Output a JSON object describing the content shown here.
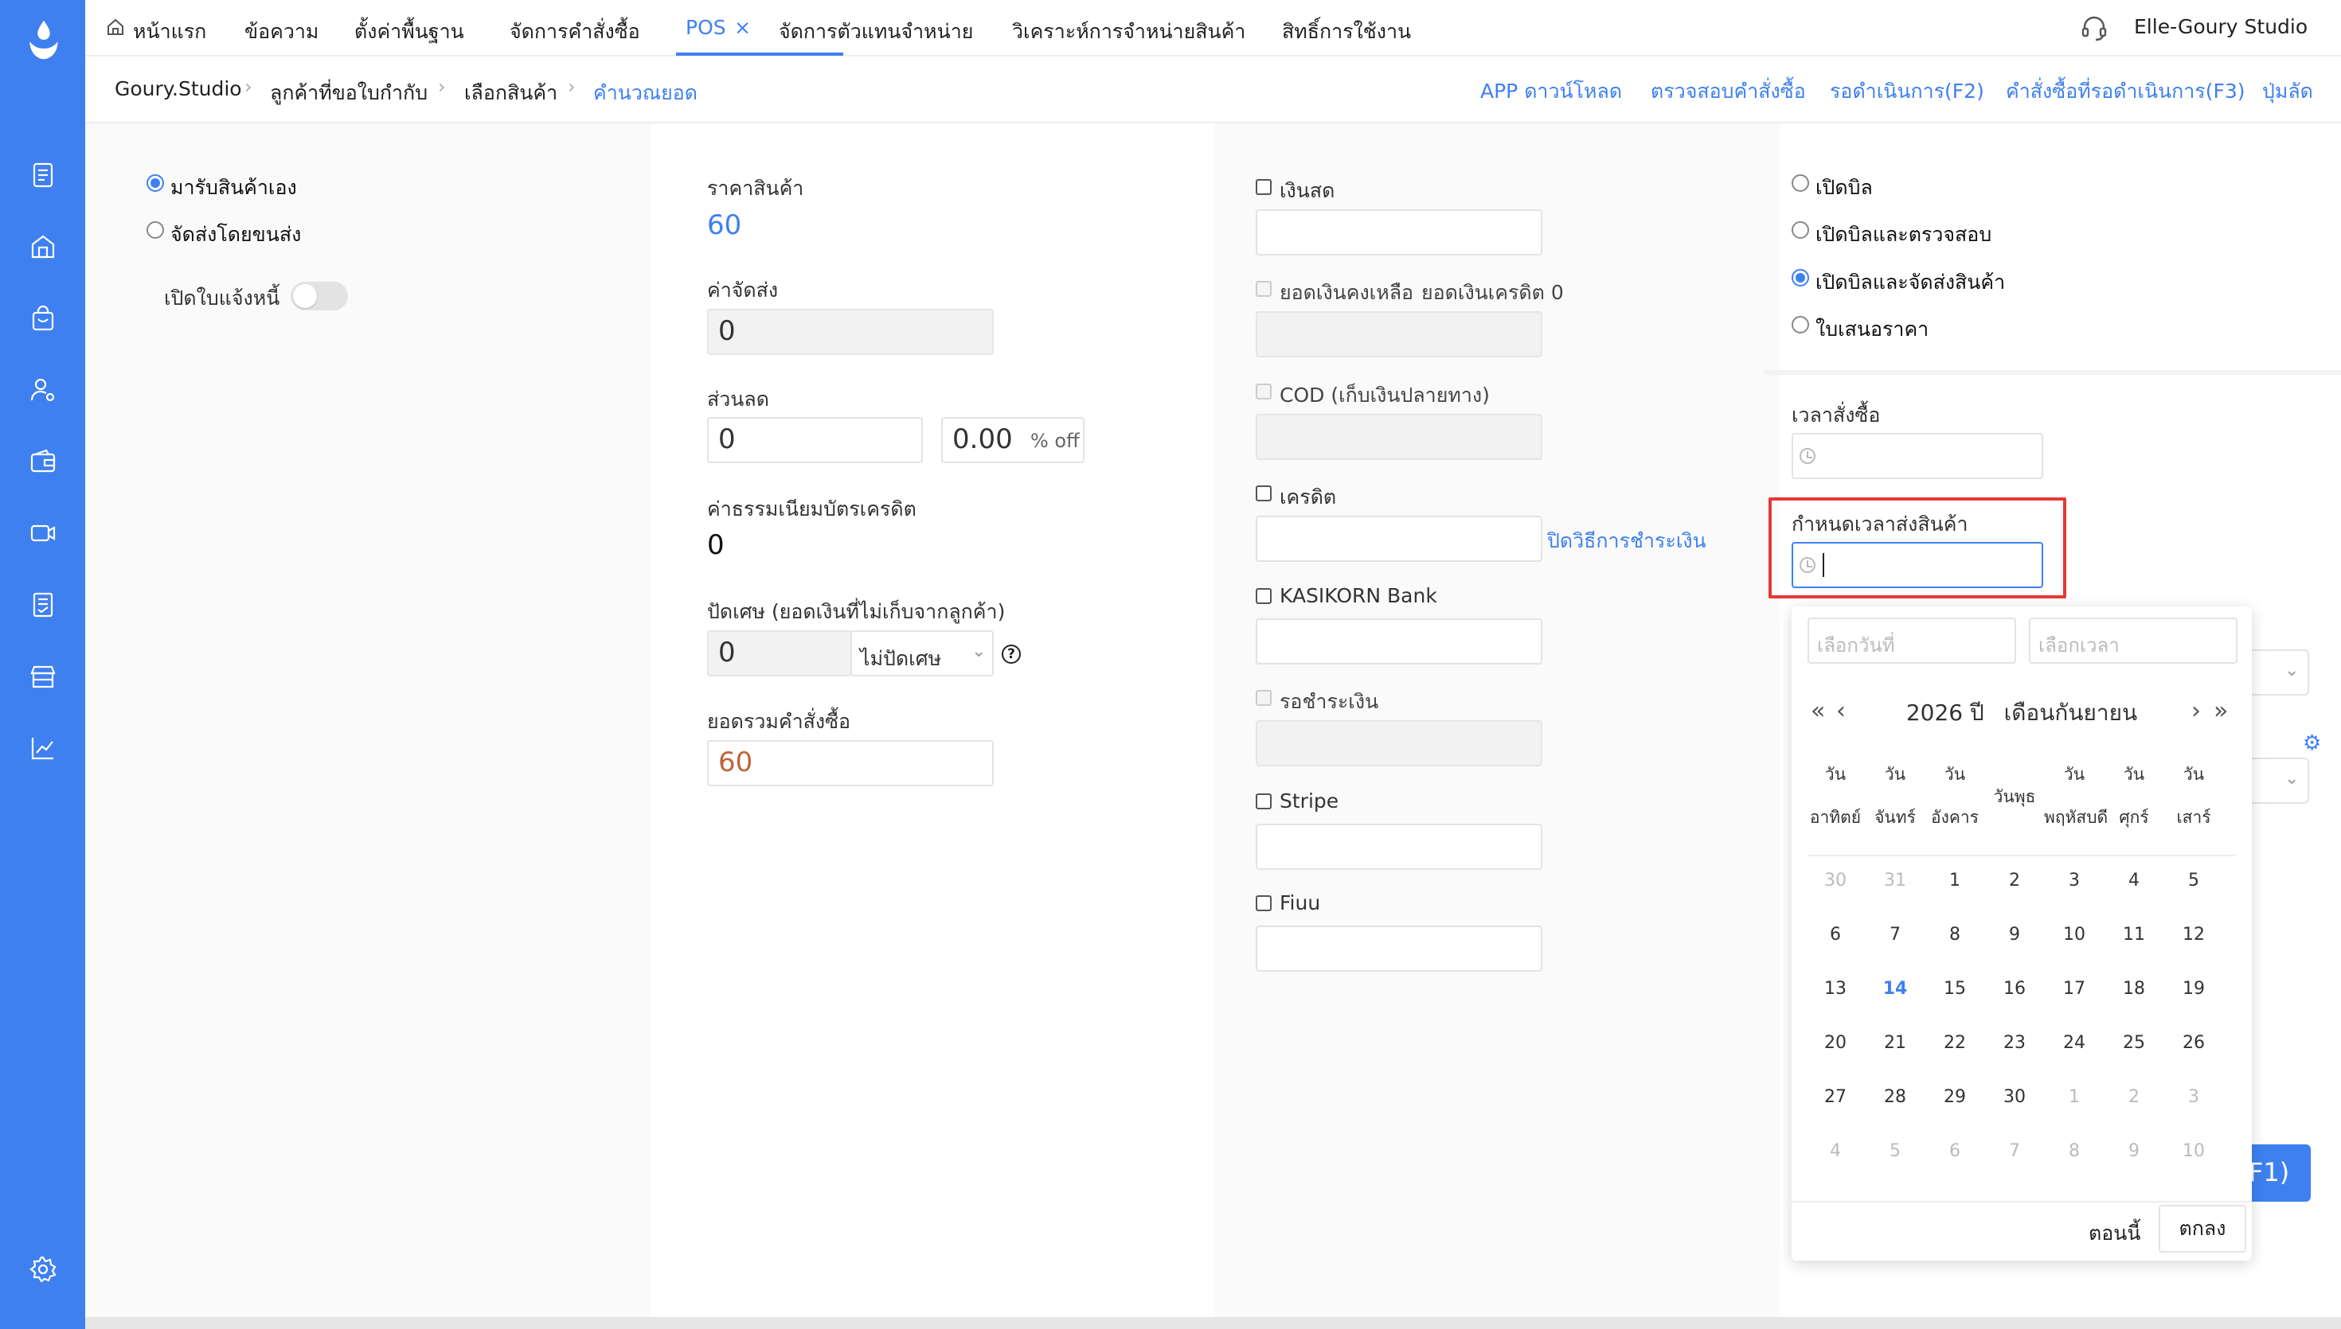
{
  "colors": {
    "brand": "#3f80f0",
    "highlight": "#e53935",
    "price": "#3f80f0",
    "total": "#c0643c"
  },
  "sidebar": {
    "icons": [
      "logo-drop-icon",
      "document-icon",
      "store-icon",
      "shopping-bag-icon",
      "user-gear-icon",
      "wallet-icon",
      "video-icon",
      "report-icon",
      "shop-icon",
      "chart-icon",
      "gear-icon"
    ]
  },
  "nav": {
    "home": "หน้าแรก",
    "messages": "ข้อความ",
    "basic_settings": "ตั้งค่าพื้นฐาน",
    "orders": "จัดการคำสั่งซื้อ",
    "pos": "POS",
    "pos_close": "×",
    "agents": "จัดการตัวแทนจำหน่าย",
    "analytics": "วิเคราะห์การจำหน่ายสินค้า",
    "permissions": "สิทธิ์การใช้งาน",
    "account": "Elle-Goury Studio"
  },
  "breadcrumb": {
    "items": [
      "Goury.Studio",
      "ลูกค้าที่ขอใบกำกับ",
      "เลือกสินค้า",
      "คำนวณยอด"
    ],
    "separator": "›"
  },
  "actions": {
    "app_download": "APP ดาวน์โหลด",
    "check_orders": "ตรวจสอบคำสั่งซื้อ",
    "pending": "รอดำเนินการ(F2)",
    "pending_orders": "คำสั่งซื้อที่รอดำเนินการ(F3)",
    "shortcuts": "ปุ่มลัด"
  },
  "delivery": {
    "pickup": "มารับสินค้าเอง",
    "courier": "จัดส่งโดยขนส่ง",
    "selected": "pickup",
    "invoice_toggle_label": "เปิดใบแจ้งหนี้",
    "invoice_toggle_on": false
  },
  "pricing": {
    "price_label": "ราคาสินค้า",
    "price_value": "60",
    "shipping_label": "ค่าจัดส่ง",
    "shipping_value": "0",
    "discount_label": "ส่วนลด",
    "discount_value": "0",
    "discount_percent": "0.00",
    "discount_unit": "% off",
    "card_fee_label": "ค่าธรรมเนียมบัตรเครดิต",
    "card_fee_value": "0",
    "rounding_label": "ปัดเศษ (ยอดเงินที่ไม่เก็บจากลูกค้า)",
    "rounding_value": "0",
    "rounding_select": "ไม่ปัดเศษ",
    "total_label": "ยอดรวมคำสั่งซื้อ",
    "total_value": "60"
  },
  "payment": {
    "cash": "เงินสด",
    "balance": "ยอดเงินคงเหลือ",
    "credit_balance": "ยอดเงินเครดิต 0",
    "cod": "COD (เก็บเงินปลายทาง)",
    "credit": "เครดิต",
    "close_method_link": "ปิดวิธีการชำระเงิน",
    "kasikorn": "KASIKORN Bank",
    "pending_payment": "รอชำระเงิน",
    "stripe": "Stripe",
    "fiuu": "Fiuu"
  },
  "bill": {
    "open_bill": "เปิดบิล",
    "open_and_check": "เปิดบิลและตรวจสอบ",
    "open_and_ship": "เปิดบิลและจัดส่งสินค้า",
    "quotation": "ใบเสนอราคา",
    "selected": "open_and_ship",
    "order_time_label": "เวลาสั่งซื้อ",
    "ship_time_label": "กำหนดเวลาส่งสินค้า",
    "submit_fragment": "F1)"
  },
  "datepicker": {
    "date_placeholder": "เลือกวันที่",
    "time_placeholder": "เลือกเวลา",
    "year": "2026 ปี",
    "month": "เดือนกันยายน",
    "prev_year": "«",
    "prev_month": "‹",
    "next_month": "›",
    "next_year": "»",
    "weekdays": [
      [
        "วัน",
        "อาทิตย์"
      ],
      [
        "วัน",
        "จันทร์"
      ],
      [
        "วัน",
        "อังคาร"
      ],
      [
        "วันพุธ",
        ""
      ],
      [
        "วัน",
        "พฤหัสบดี"
      ],
      [
        "วัน",
        "ศุกร์"
      ],
      [
        "วัน",
        "เสาร์"
      ]
    ],
    "weeks": [
      [
        "30",
        "31",
        "1",
        "2",
        "3",
        "4",
        "5"
      ],
      [
        "6",
        "7",
        "8",
        "9",
        "10",
        "11",
        "12"
      ],
      [
        "13",
        "14",
        "15",
        "16",
        "17",
        "18",
        "19"
      ],
      [
        "20",
        "21",
        "22",
        "23",
        "24",
        "25",
        "26"
      ],
      [
        "27",
        "28",
        "29",
        "30",
        "1",
        "2",
        "3"
      ],
      [
        "4",
        "5",
        "6",
        "7",
        "8",
        "9",
        "10"
      ]
    ],
    "muted_leading": 2,
    "muted_trailing_from": "27-row-index-4-col-4",
    "today": "14",
    "now": "ตอนนี้",
    "ok": "ตกลง"
  }
}
